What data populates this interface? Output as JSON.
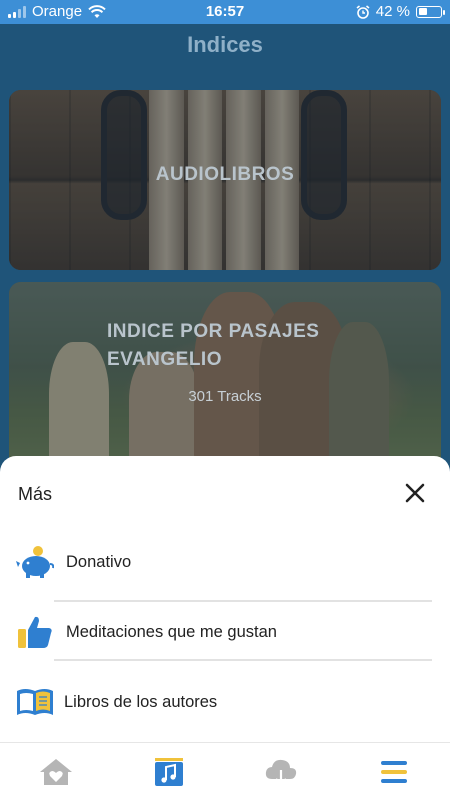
{
  "status_bar": {
    "carrier": "Orange",
    "time": "16:57",
    "battery_percent": "42 %",
    "battery_level": 0.42,
    "icons": [
      "signal-icon",
      "wifi-icon",
      "alarm-icon",
      "battery-icon"
    ]
  },
  "header": {
    "title": "Indices"
  },
  "cards": [
    {
      "title": "AUDIOLIBROS",
      "subtitle": ""
    },
    {
      "title_line1": "INDICE POR PASAJES",
      "title_line2": "EVANGELIO",
      "subtitle": "301 Tracks"
    }
  ],
  "sheet": {
    "title": "Más",
    "close_icon": "close-icon",
    "items": [
      {
        "label": "Donativo",
        "icon": "piggy-bank-icon"
      },
      {
        "label": "Meditaciones que me gustan",
        "icon": "thumbs-up-icon"
      },
      {
        "label": "Libros de los autores",
        "icon": "book-icon"
      }
    ]
  },
  "tab_bar": {
    "tabs": [
      {
        "icon": "home-heart-icon",
        "active": false
      },
      {
        "icon": "music-note-icon",
        "active": true
      },
      {
        "icon": "cloud-download-icon",
        "active": false
      },
      {
        "icon": "menu-icon",
        "active": true
      }
    ]
  },
  "colors": {
    "status_bar": "#3d8fd6",
    "background": "#1f5479",
    "accent_blue": "#2f7fd0",
    "accent_yellow": "#f0c23b",
    "tab_inactive": "#b5b5b5"
  }
}
